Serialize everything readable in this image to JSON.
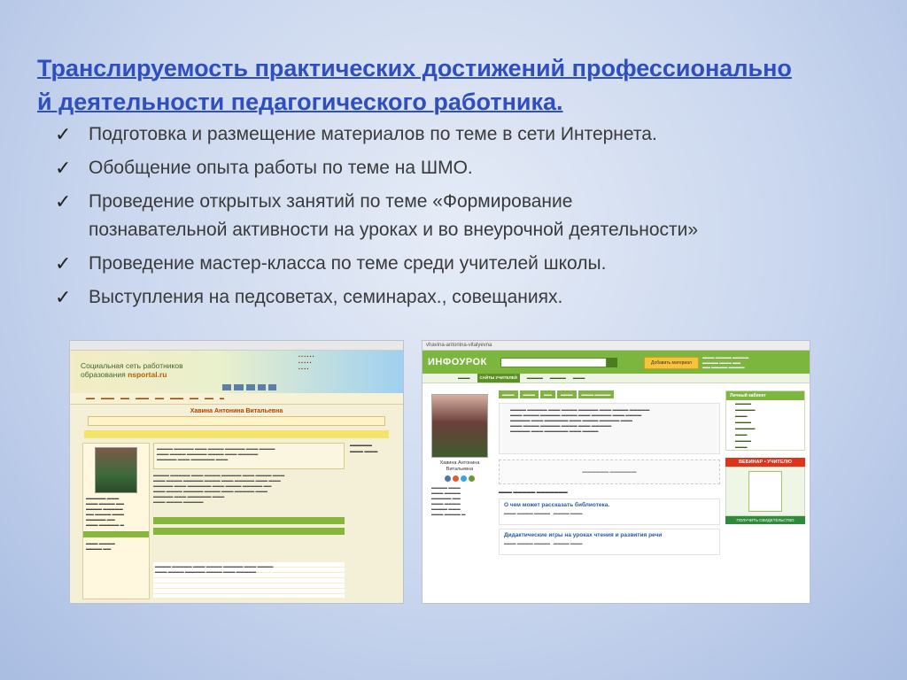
{
  "title": {
    "line1": "Транслируемость практических достижений профессионально",
    "line2": "й деятельности педагогического работника."
  },
  "bullets": [
    {
      "lines": [
        "Подготовка и размещение материалов по теме в сети Интернета."
      ]
    },
    {
      "lines": [
        "Обобщение опыта работы по теме на ШМО."
      ]
    },
    {
      "lines": [
        "Проведение открытых занятий по теме «Формирование",
        "познавательной активности на уроках и во внеурочной деятельности»"
      ]
    },
    {
      "lines": [
        "Проведение мастер-класса по теме среди учителей школы."
      ]
    },
    {
      "lines": [
        "Выступления на педсоветах, семинарах., совещаниях."
      ]
    }
  ],
  "check_icon": "✓",
  "screenshot_left": {
    "logo_line1": "Социальная сеть работников",
    "logo_line2_prefix": "образования",
    "logo_line2_site": "nsportal.ru",
    "profile_name": "Хавина Антонина Витальевна"
  },
  "screenshot_right": {
    "url": "vhavina-antonina-vitalyevna",
    "brand": "ИНФОУРОК",
    "add_button": "Добавить материал",
    "nav_active": "САЙТЫ УЧИТЕЛЕЙ",
    "teacher_name_line1": "Хавина Антонина",
    "teacher_name_line2": "Витальевна",
    "cabinet_title": "Личный кабинет",
    "material_title_1": "О чем может рассказать библиотека.",
    "material_title_2": "Дидактические игры на уроках чтения и развития речи",
    "webinar": "ВЕБИНАР • УЧИТЕЛЮ",
    "get_cert": "ПОЛУЧИТЬ СВИДЕТЕЛЬСТВО"
  }
}
